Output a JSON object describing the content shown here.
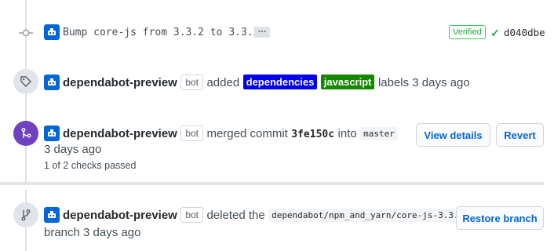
{
  "commit": {
    "message": "Bump core-js from 3.3.2 to 3.3.3",
    "ellipsis": "…",
    "verified": "Verified",
    "sha": "d040dbe"
  },
  "labels_event": {
    "author": "dependabot-preview",
    "bot_badge": "bot",
    "action": "added",
    "labels": [
      {
        "name": "dependencies",
        "color": "#0000ee"
      },
      {
        "name": "javascript",
        "color": "#168700"
      }
    ],
    "suffix": "labels 3 days ago"
  },
  "merge_event": {
    "author": "dependabot-preview",
    "bot_badge": "bot",
    "action": "merged commit",
    "commit_sha": "3fe150c",
    "into": "into",
    "branch": "master",
    "time": "3 days ago",
    "checks": "1 of 2 checks passed",
    "view_details_label": "View details",
    "revert_label": "Revert",
    "badge_color": "#6f42c1"
  },
  "delete_event": {
    "author": "dependabot-preview",
    "bot_badge": "bot",
    "action": "deleted the",
    "branch": "dependabot/npm_and_yarn/core-js-3.3.3",
    "time": "branch 3 days ago",
    "restore_label": "Restore branch"
  },
  "icons": {
    "commit": "git-commit-icon",
    "tag": "tag-icon",
    "merge": "git-merge-icon",
    "branch": "git-branch-icon",
    "bot": "dependabot-icon"
  }
}
